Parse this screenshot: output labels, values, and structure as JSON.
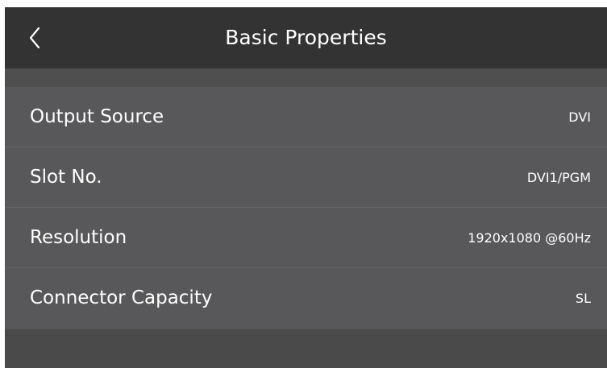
{
  "header": {
    "title": "Basic Properties",
    "back_icon": "chevron-left-icon"
  },
  "properties": [
    {
      "label": "Output Source",
      "value": "DVI"
    },
    {
      "label": "Slot No.",
      "value": "DVI1/PGM"
    },
    {
      "label": "Resolution",
      "value": "1920x1080 @60Hz"
    },
    {
      "label": "Connector Capacity",
      "value": "SL"
    }
  ],
  "colors": {
    "header_bg": "#333334",
    "row_bg": "#58585a",
    "screen_bg": "#4a4a4b",
    "text": "#ffffff"
  }
}
